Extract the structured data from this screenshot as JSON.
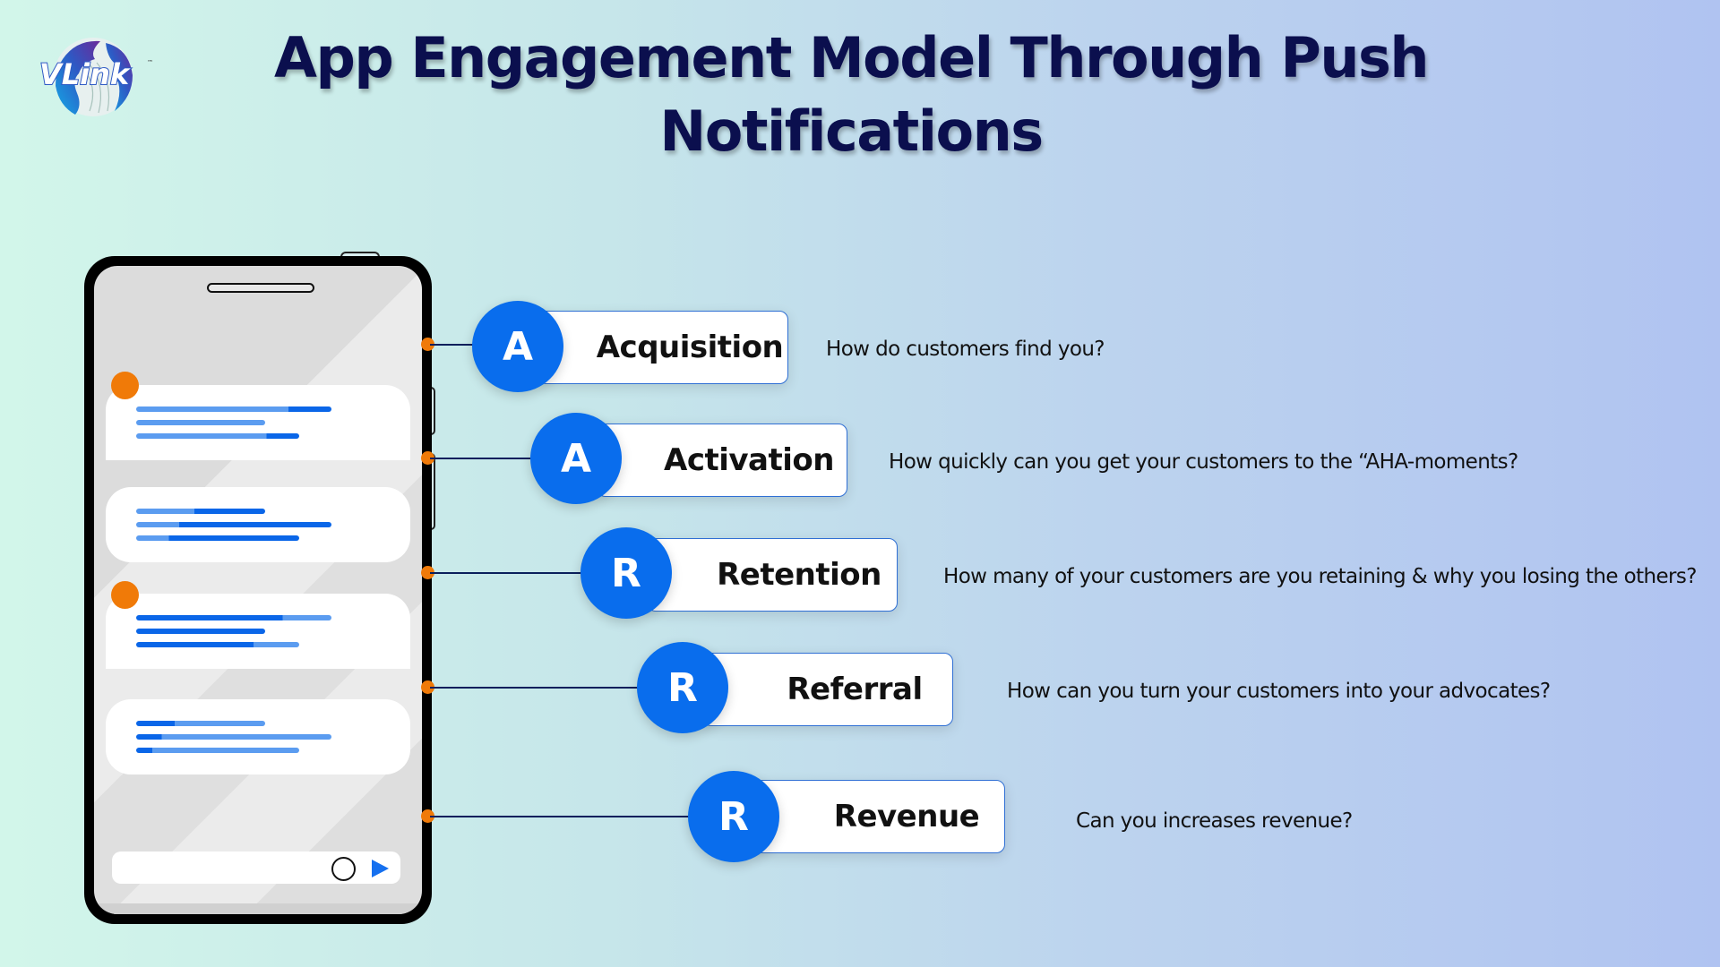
{
  "brand": {
    "logo_text": "VLink",
    "trademark": "™"
  },
  "title": {
    "line1": "App Engagement Model Through Push",
    "line2": "Notifications"
  },
  "colors": {
    "title": "#0b0f4e",
    "circle": "#096ded",
    "accent_orange": "#f07a08",
    "box_border": "#2f6fd4",
    "connector": "#0a1f5c",
    "bar_light": "#5b9cf0",
    "bar_dark": "#0a66e8"
  },
  "stages": [
    {
      "letter": "A",
      "label": "Acquisition",
      "question": "How do customers find you?"
    },
    {
      "letter": "A",
      "label": "Activation",
      "question": "How quickly can you get your customers to the “AHA-moments?"
    },
    {
      "letter": "R",
      "label": "Retention",
      "question": "How many of your customers are you retaining & why you losing the others?"
    },
    {
      "letter": "R",
      "label": "Referral",
      "question": "How can you turn your customers into your advocates?"
    },
    {
      "letter": "R",
      "label": "Revenue",
      "question": "Can you increases revenue?"
    }
  ],
  "phone": {
    "notifications": [
      {
        "unread": true
      },
      {
        "unread": false
      },
      {
        "unread": true
      },
      {
        "unread": false
      }
    ]
  }
}
